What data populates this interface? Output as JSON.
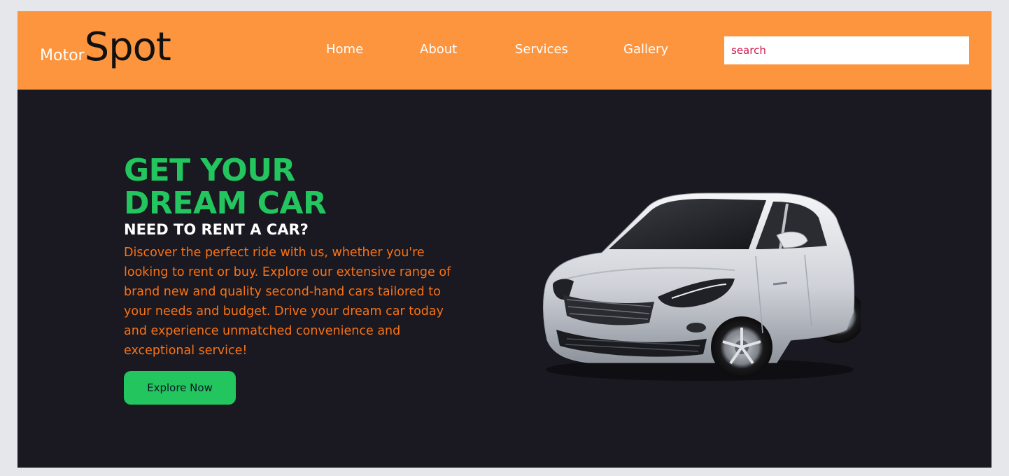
{
  "logo": {
    "small": "Motor",
    "big": "Spot"
  },
  "nav": {
    "items": [
      "Home",
      "About",
      "Services",
      "Gallery"
    ]
  },
  "search": {
    "placeholder": "search"
  },
  "hero": {
    "title_line1": "GET YOUR",
    "title_line2": "DREAM CAR",
    "subtitle": "NEED TO RENT A CAR?",
    "description": "Discover the perfect ride with us, whether you're looking to rent or buy. Explore our extensive range of brand new and quality second-hand cars tailored to your needs and budget. Drive your dream car today and experience unmatched convenience and exceptional service!",
    "cta_label": "Explore Now"
  },
  "colors": {
    "header_bg": "#fd953f",
    "hero_bg": "#1a1820",
    "accent_green": "#22c55e",
    "text_orange": "#f97316"
  },
  "icons": {
    "car_image": "white-hatchback-car"
  }
}
